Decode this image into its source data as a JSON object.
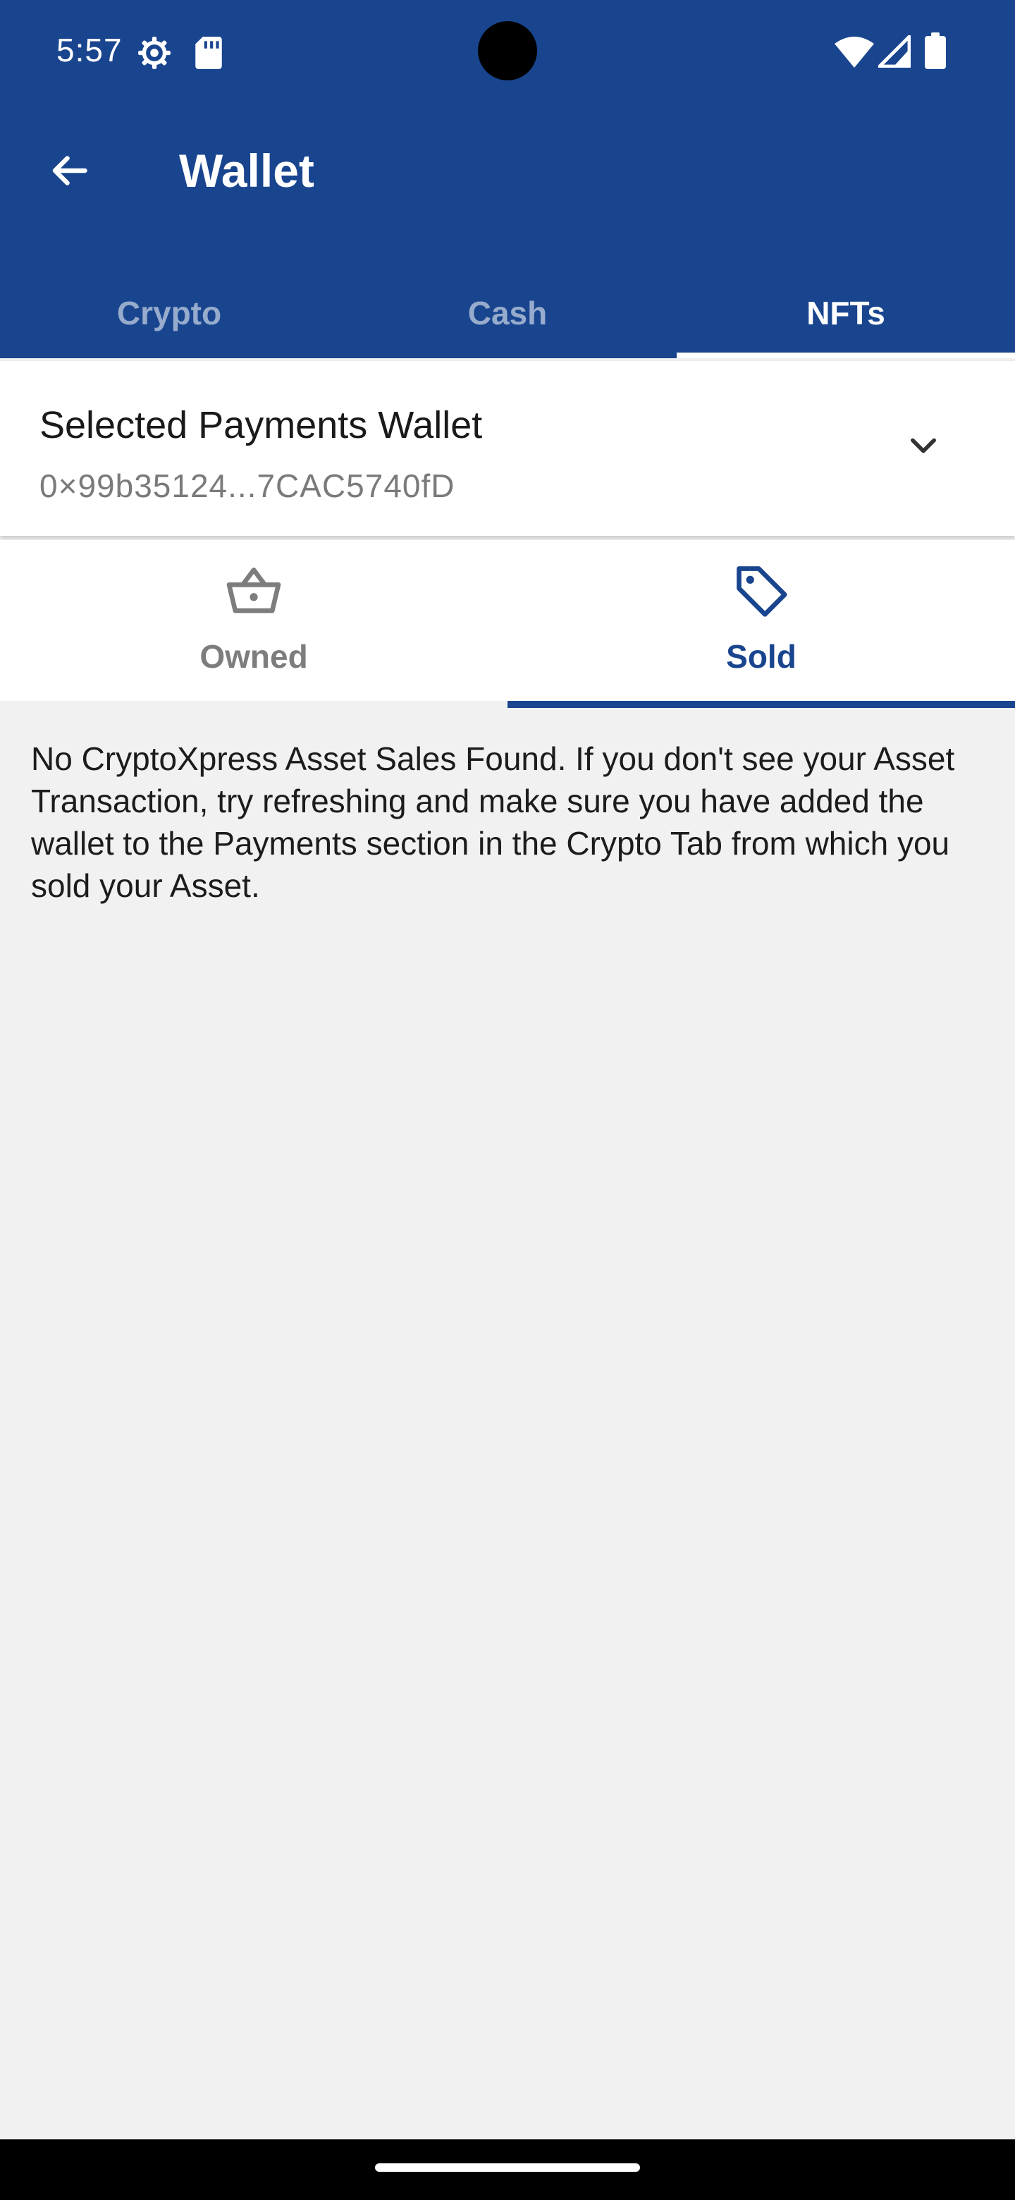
{
  "status_bar": {
    "time": "5:57",
    "icons": [
      "gear-icon",
      "sd-card-icon",
      "wifi-icon",
      "signal-icon",
      "battery-icon"
    ]
  },
  "header": {
    "title": "Wallet",
    "back_icon": "arrow-left-icon"
  },
  "top_tabs": [
    {
      "label": "Crypto",
      "active": false
    },
    {
      "label": "Cash",
      "active": false
    },
    {
      "label": "NFTs",
      "active": true
    }
  ],
  "wallet_selector": {
    "title": "Selected Payments Wallet",
    "address": "0×99b35124...7CAC5740fD",
    "icon": "chevron-down-icon"
  },
  "sub_tabs": [
    {
      "label": "Owned",
      "icon": "basket-icon",
      "active": false
    },
    {
      "label": "Sold",
      "icon": "tag-icon",
      "active": true
    }
  ],
  "empty_state": {
    "message": "No CryptoXpress Asset Sales Found. If you don't see your Asset Transaction, try refreshing and make sure you have added the wallet to the Payments section in the Crypto Tab from which you sold your Asset."
  },
  "colors": {
    "primary": "#19458f",
    "background": "#f1f1f1",
    "surface": "#ffffff",
    "inactive_text": "#7d7d7d"
  }
}
